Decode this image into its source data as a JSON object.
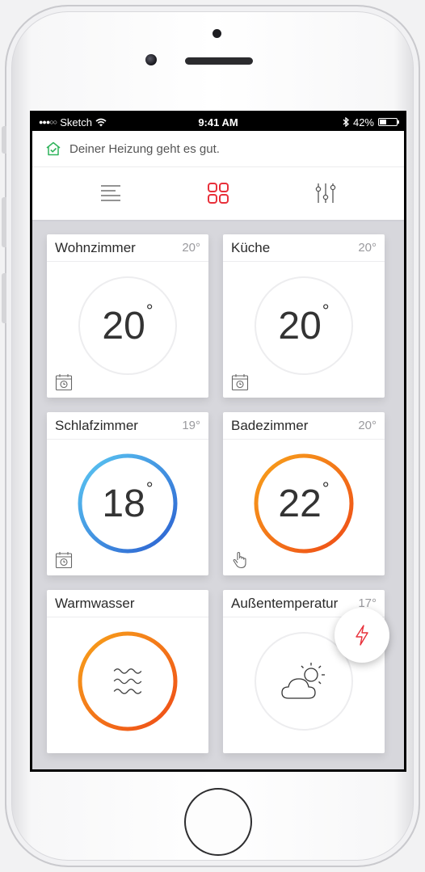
{
  "status_bar": {
    "carrier": "Sketch",
    "time": "9:41 AM",
    "battery": "42%",
    "battery_fraction": 0.42
  },
  "header": {
    "status_message": "Deiner Heizung geht es gut.",
    "tabs": [
      {
        "icon": "list-icon",
        "active": false
      },
      {
        "icon": "grid-icon",
        "active": true
      },
      {
        "icon": "sliders-icon",
        "active": false
      }
    ]
  },
  "rooms": [
    {
      "name": "Wohnzimmer",
      "setpoint": "20°",
      "current": "20",
      "mode": "schedule",
      "ring": "none"
    },
    {
      "name": "Küche",
      "setpoint": "20°",
      "current": "20",
      "mode": "schedule",
      "ring": "none"
    },
    {
      "name": "Schlafzimmer",
      "setpoint": "19°",
      "current": "18",
      "mode": "schedule",
      "ring": "cool"
    },
    {
      "name": "Badezimmer",
      "setpoint": "20°",
      "current": "22",
      "mode": "manual",
      "ring": "heat"
    },
    {
      "name": "Warmwasser",
      "setpoint": "",
      "current": "",
      "mode": "water",
      "ring": "heat"
    },
    {
      "name": "Außentemperatur",
      "setpoint": "17°",
      "current": "",
      "mode": "weather",
      "ring": "none"
    }
  ],
  "colors": {
    "accent": "#e8303a",
    "cool_start": "#5bc8f2",
    "cool_end": "#2b5fd0",
    "heat_start": "#f7a21b",
    "heat_end": "#ef4b17",
    "ok_green": "#2fb35b"
  },
  "fab": {
    "icon": "lightning-icon"
  }
}
